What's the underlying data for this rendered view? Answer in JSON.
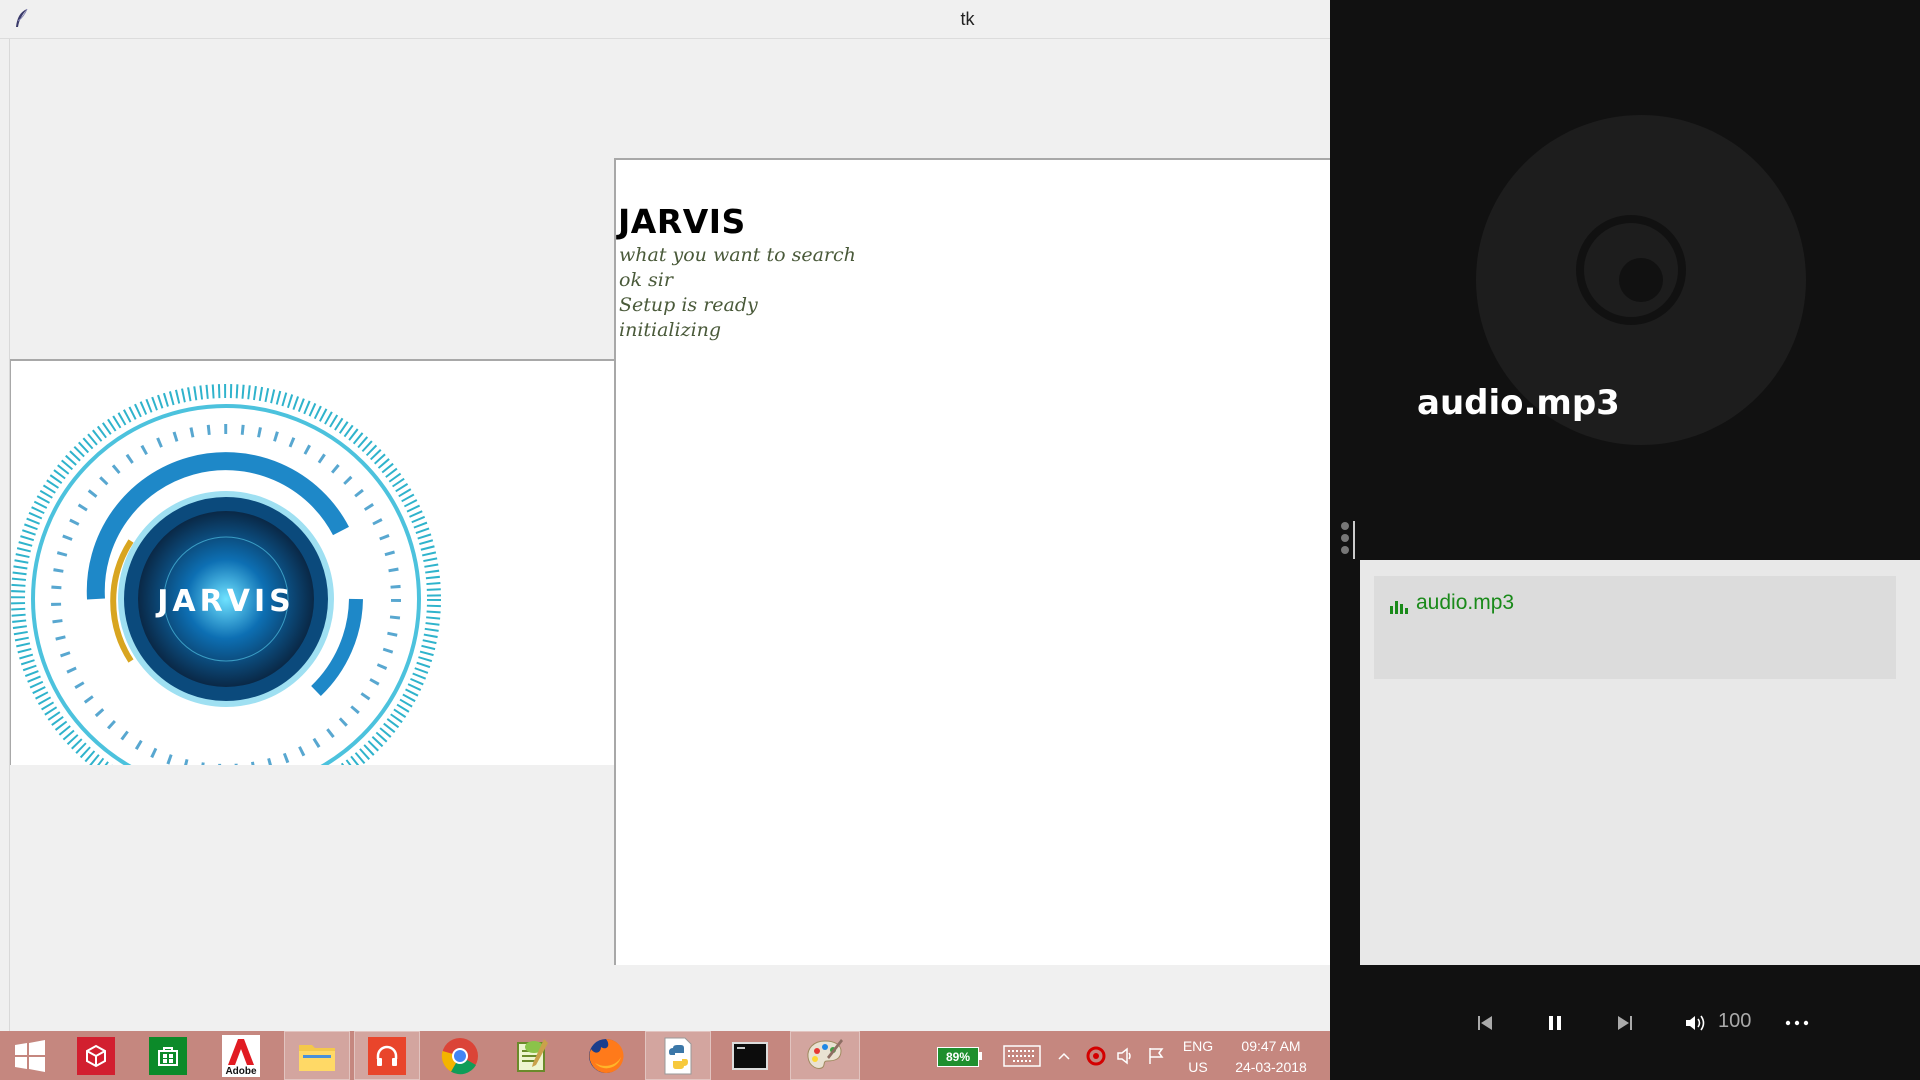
{
  "window": {
    "title": "tk"
  },
  "jarvis": {
    "heading": "JARVIS",
    "log": [
      "what you want to search",
      "ok sir",
      "Setup is ready",
      "initializing"
    ],
    "logo_text": "JARVIS"
  },
  "taskbar": {
    "apps": [
      {
        "name": "start",
        "icon": "windows-logo-icon"
      },
      {
        "name": "3d-app",
        "icon": "red-cube-icon"
      },
      {
        "name": "store",
        "icon": "store-icon"
      },
      {
        "name": "adobe",
        "icon": "adobe-icon",
        "label": "Adobe"
      },
      {
        "name": "file-explorer",
        "icon": "folder-icon"
      },
      {
        "name": "music",
        "icon": "headphones-icon"
      },
      {
        "name": "chrome",
        "icon": "chrome-icon"
      },
      {
        "name": "notepad-plus",
        "icon": "notepad-plus-icon"
      },
      {
        "name": "firefox",
        "icon": "firefox-icon"
      },
      {
        "name": "python",
        "icon": "python-icon"
      },
      {
        "name": "cmd",
        "icon": "terminal-icon"
      },
      {
        "name": "paint",
        "icon": "palette-icon"
      }
    ],
    "battery": "89%",
    "language_top": "ENG",
    "language_bottom": "US",
    "time": "09:47 AM",
    "date": "24-03-2018"
  },
  "player": {
    "now_playing": "audio.mp3",
    "playlist": [
      "audio.mp3"
    ],
    "volume": "100",
    "colors": {
      "accent": "#1a8a1a",
      "background": "#111111"
    }
  }
}
